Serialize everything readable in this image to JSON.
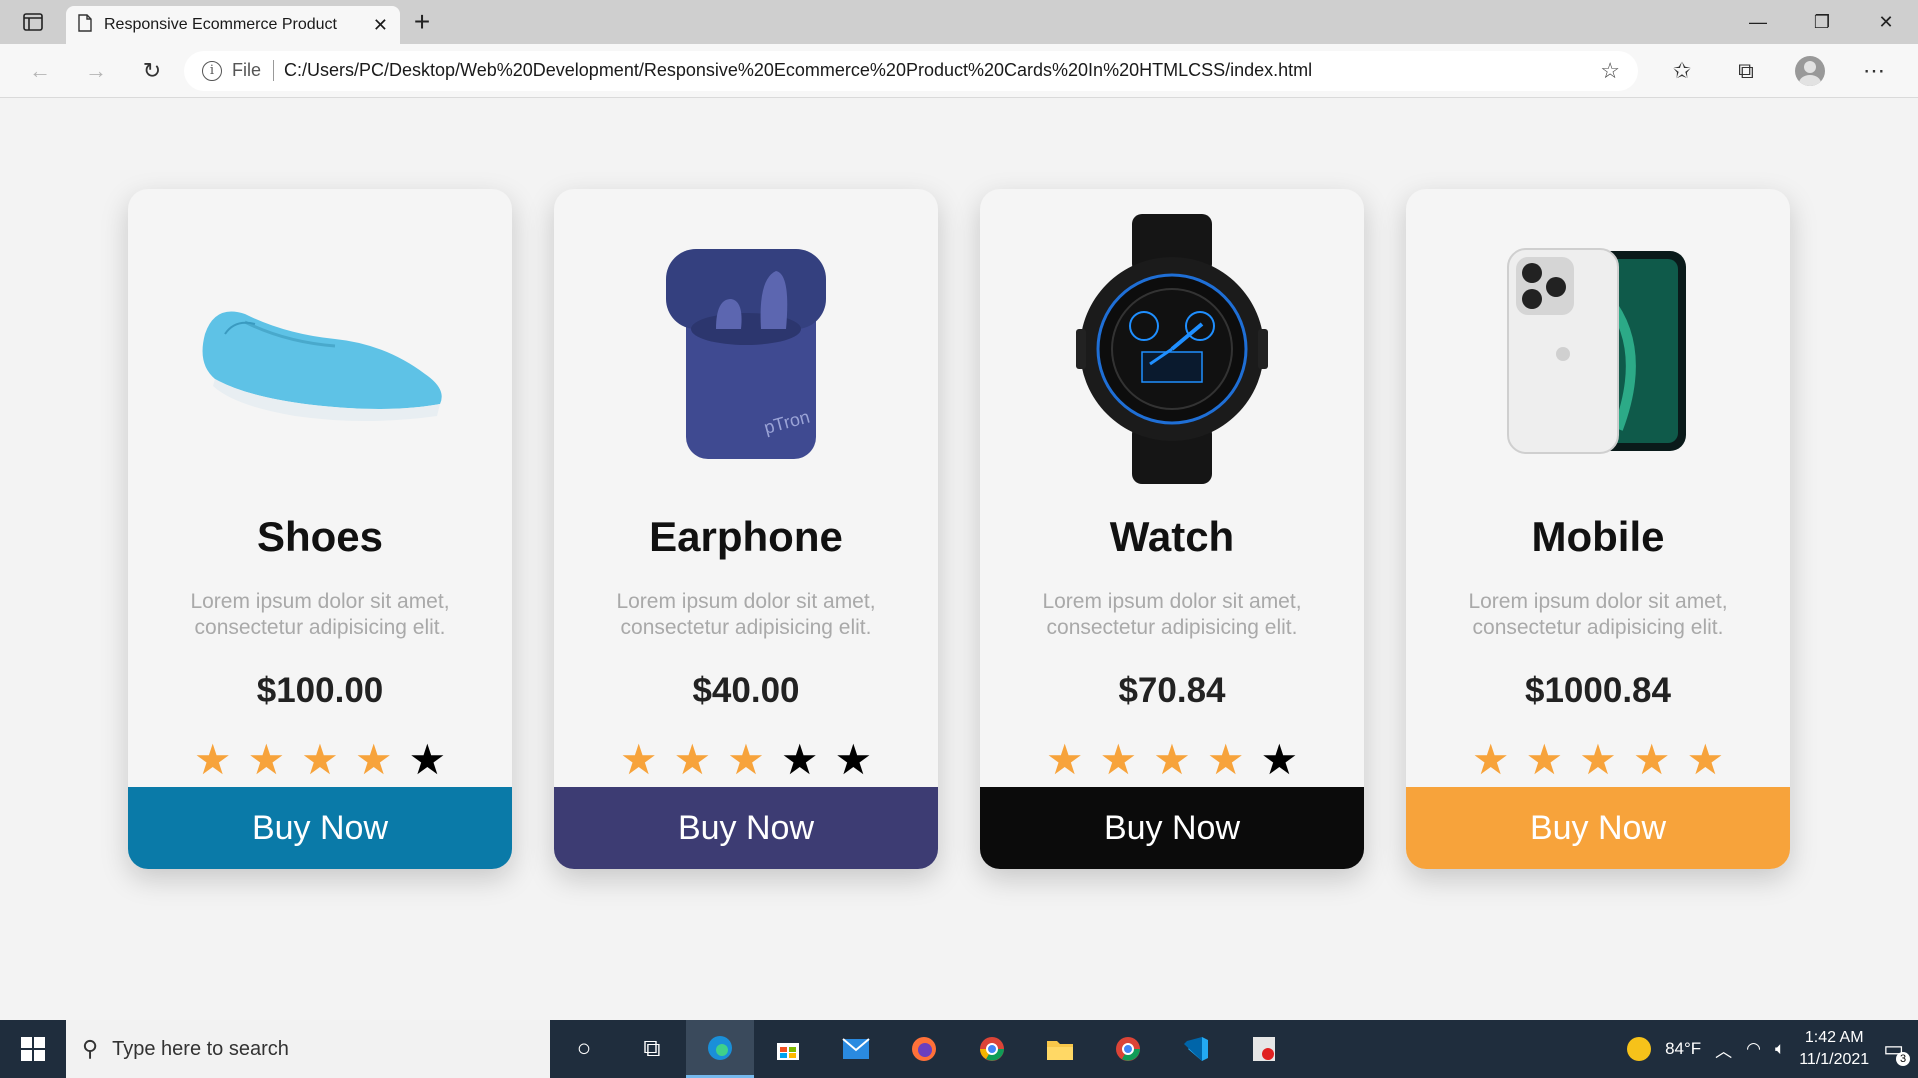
{
  "browser": {
    "tab_title": "Responsive Ecommerce Product",
    "new_tab": "+",
    "address": {
      "file_label": "File",
      "url": "C:/Users/PC/Desktop/Web%20Development/Responsive%20Ecommerce%20Product%20Cards%20In%20HTMLCSS/index.html"
    }
  },
  "products": [
    {
      "name": "Shoes",
      "desc": "Lorem ipsum dolor sit amet, consectetur adipisicing elit.",
      "price": "$100.00",
      "rating": 4,
      "button": "Buy Now",
      "button_color": "#0a7aa8"
    },
    {
      "name": "Earphone",
      "desc": "Lorem ipsum dolor sit amet, consectetur adipisicing elit.",
      "price": "$40.00",
      "rating": 3,
      "button": "Buy Now",
      "button_color": "#3d3c73"
    },
    {
      "name": "Watch",
      "desc": "Lorem ipsum dolor sit amet, consectetur adipisicing elit.",
      "price": "$70.84",
      "rating": 4,
      "button": "Buy Now",
      "button_color": "#0b0b0b"
    },
    {
      "name": "Mobile",
      "desc": "Lorem ipsum dolor sit amet, consectetur adipisicing elit.",
      "price": "$1000.84",
      "rating": 5,
      "button": "Buy Now",
      "button_color": "#f7a33b"
    }
  ],
  "star_colors": {
    "on": "#f7a33b",
    "off": "#000000"
  },
  "taskbar": {
    "search_placeholder": "Type here to search",
    "weather": "84°F",
    "time": "1:42 AM",
    "date": "11/1/2021",
    "notifications": "3"
  }
}
